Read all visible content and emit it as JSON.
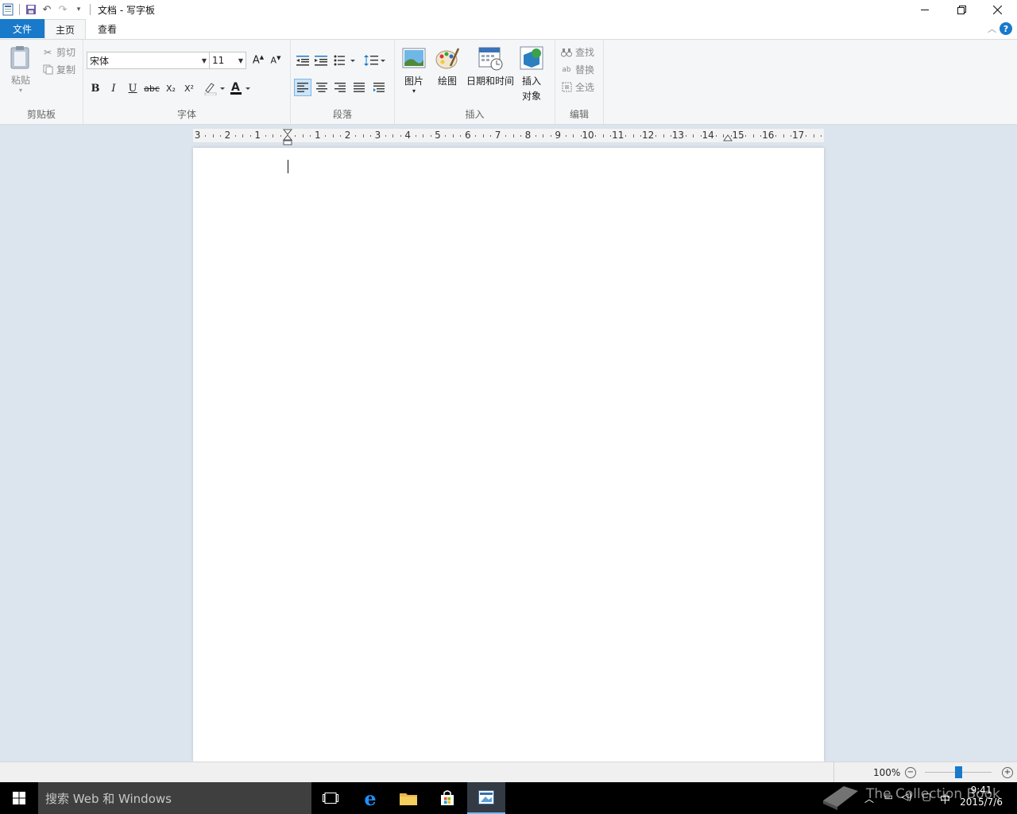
{
  "window": {
    "title": "文档 - 写字板"
  },
  "tabs": {
    "file": "文件",
    "home": "主页",
    "view": "查看"
  },
  "clipboard": {
    "paste": "粘贴",
    "cut": "剪切",
    "copy": "复制",
    "label": "剪贴板"
  },
  "font": {
    "family": "宋体",
    "size": "11",
    "bold": "B",
    "italic": "I",
    "underline": "U",
    "strike": "abc",
    "subscript": "X₂",
    "superscript": "X²",
    "color_letter": "A",
    "label": "字体"
  },
  "paragraph": {
    "label": "段落"
  },
  "insert": {
    "picture": "图片",
    "paint": "绘图",
    "datetime": "日期和时间",
    "object_line1": "插入",
    "object_line2": "对象",
    "label": "插入"
  },
  "editing": {
    "find": "查找",
    "replace": "替换",
    "select_all": "全选",
    "label": "编辑"
  },
  "ruler": {
    "labels": [
      "3",
      "2",
      "1",
      "1",
      "2",
      "3",
      "4",
      "5",
      "6",
      "7",
      "8",
      "9",
      "10",
      "11",
      "12",
      "13",
      "14",
      "15",
      "16",
      "17"
    ]
  },
  "status": {
    "zoom": "100%"
  },
  "taskbar": {
    "search_placeholder": "搜索 Web 和 Windows",
    "time": "9:41",
    "date": "2015/7/6",
    "ime": "中"
  },
  "watermark": "The Collection Book",
  "colors": {
    "accent": "#1979ca",
    "ribbon_bg": "#f5f6f7",
    "workspace": "#dce4ee",
    "taskbar": "#000000"
  }
}
